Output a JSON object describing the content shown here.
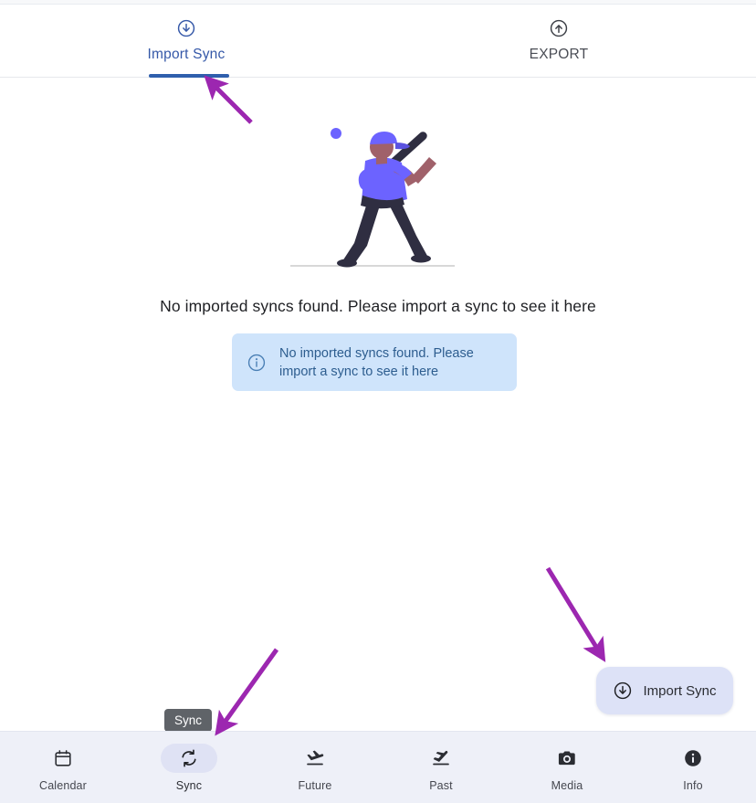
{
  "tabs": [
    {
      "label": "Import Sync",
      "icon": "download-circle-icon",
      "active": true
    },
    {
      "label": "EXPORT",
      "icon": "upload-circle-icon",
      "active": false
    }
  ],
  "illustration": {
    "name": "baseball-batter-illustration",
    "colors": {
      "shirt": "#6c63ff",
      "cap": "#6c63ff",
      "pants": "#2f2e41",
      "skin": "#a0616a",
      "bat": "#2f2e41",
      "ball": "#6c63ff",
      "ground": "#cccccc"
    }
  },
  "empty_state": {
    "title": "No imported syncs found. Please import a sync to see it here"
  },
  "snackbar": {
    "icon": "info-circle-icon",
    "message": "No imported syncs found. Please import a sync to see it here",
    "background": "#cfe4fb",
    "text_color": "#2d5d8f"
  },
  "fab": {
    "label": "Import Sync",
    "icon": "download-circle-icon",
    "background": "#dde2f7"
  },
  "tooltip": {
    "label": "Sync"
  },
  "bottom_nav": {
    "items": [
      {
        "label": "Calendar",
        "icon": "calendar-icon",
        "active": false
      },
      {
        "label": "Sync",
        "icon": "sync-icon",
        "active": true
      },
      {
        "label": "Future",
        "icon": "plane-landing-icon",
        "active": false
      },
      {
        "label": "Past",
        "icon": "plane-takeoff-icon",
        "active": false
      },
      {
        "label": "Media",
        "icon": "camera-icon",
        "active": false
      },
      {
        "label": "Info",
        "icon": "info-filled-icon",
        "active": false
      }
    ]
  },
  "annotations": {
    "color": "#9c27b0",
    "arrows": [
      {
        "name": "arrow-to-import-sync-tab",
        "points_to": "Import Sync tab indicator"
      },
      {
        "name": "arrow-to-sync-nav-item",
        "points_to": "Sync bottom nav item"
      },
      {
        "name": "arrow-to-import-sync-fab",
        "points_to": "Import Sync button"
      }
    ]
  },
  "theme": {
    "accent_blue": "#2f5fad",
    "nav_background": "#eef0f8",
    "page_background": "#ffffff"
  }
}
